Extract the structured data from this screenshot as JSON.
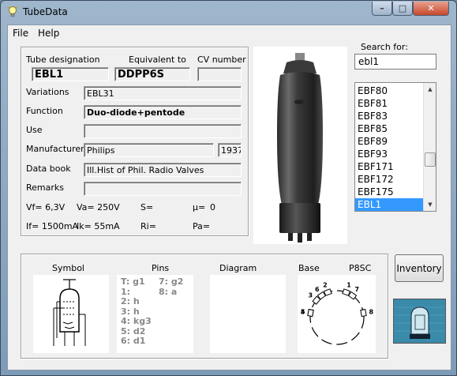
{
  "window": {
    "title": "TubeData",
    "minimize": "–",
    "maximize": "□",
    "close": "✕"
  },
  "menu": {
    "file": "File",
    "help": "Help"
  },
  "labels": {
    "tube_designation": "Tube designation",
    "equivalent_to": "Equivalent to",
    "cv_number": "CV number",
    "variations": "Variations",
    "function": "Function",
    "use": "Use",
    "manufacturer": "Manufacturer",
    "data_book": "Data book",
    "remarks": "Remarks",
    "search_for": "Search for:",
    "symbol": "Symbol",
    "pins": "Pins",
    "diagram": "Diagram",
    "base": "Base",
    "base_type": "P8SC"
  },
  "fields": {
    "tube_designation": "EBL1",
    "equivalent_to": "DDPP6S",
    "cv_number": "",
    "variations": "EBL31",
    "function": "Duo-diode+pentode",
    "use": "",
    "manufacturer": "Philips",
    "year": "1937",
    "data_book": "Ill.Hist of Phil. Radio Valves",
    "remarks": ""
  },
  "specs": {
    "vf": "Vf= 6,3V",
    "va": "Va=  250V",
    "s": "S=",
    "mu": "µ=",
    "mu_val": "0",
    "if": "If= 1500mA",
    "ik": "Ik=   55mA",
    "ri": "Ri=",
    "pa": "Pa="
  },
  "search": {
    "value": "ebl1"
  },
  "list": {
    "items": [
      "EBF80",
      "EBF81",
      "EBF83",
      "EBF85",
      "EBF89",
      "EBF93",
      "EBF171",
      "EBF172",
      "EBF175",
      "EBL1"
    ],
    "selected": "EBL1"
  },
  "pins": {
    "col1": [
      "T: g1",
      "1:",
      "2: h",
      "3: h",
      "4: kg3",
      "5: d2",
      "6: d1"
    ],
    "col2": [
      "7: g2",
      "8: a"
    ]
  },
  "base_pins": [
    "1",
    "2",
    "3",
    "4",
    "5",
    "6",
    "7",
    "8"
  ],
  "buttons": {
    "inventory": "Inventory"
  }
}
